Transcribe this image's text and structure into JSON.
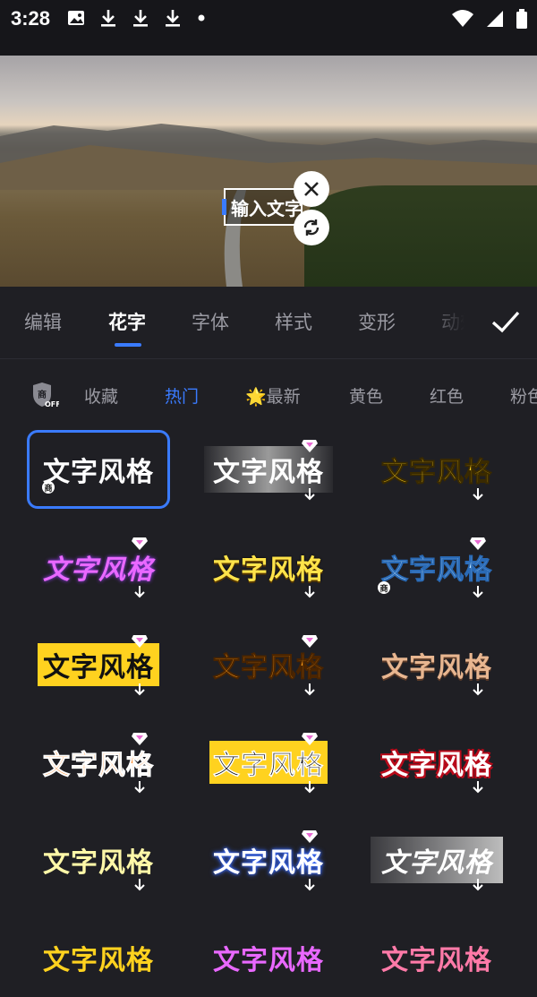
{
  "status_bar": {
    "time": "3:28",
    "icons_left": [
      "image-icon",
      "download-icon",
      "download-icon",
      "download-icon",
      "dot-icon"
    ],
    "icons_right": [
      "wifi-icon",
      "signal-icon",
      "battery-icon"
    ]
  },
  "preview": {
    "text_box_value": "输入文字",
    "controls": [
      "close-icon",
      "rotate-icon"
    ]
  },
  "tabs": [
    {
      "label": "编辑",
      "active": false
    },
    {
      "label": "花字",
      "active": true
    },
    {
      "label": "字体",
      "active": false
    },
    {
      "label": "样式",
      "active": false
    },
    {
      "label": "变形",
      "active": false
    },
    {
      "label": "动效",
      "active": false
    }
  ],
  "confirm_icon": "check-icon",
  "categories": [
    {
      "label": "",
      "icon": "shang-off-icon",
      "active": false
    },
    {
      "label": "收藏",
      "active": false
    },
    {
      "label": "热门",
      "active": true
    },
    {
      "label": "最新",
      "icon": "star-icon",
      "active": false
    },
    {
      "label": "黄色",
      "active": false
    },
    {
      "label": "红色",
      "active": false
    },
    {
      "label": "粉色",
      "active": false
    }
  ],
  "styles": {
    "sample_text": "文字风格",
    "items": [
      {
        "selected": true,
        "vip": false,
        "download": false,
        "commercial": true
      },
      {
        "selected": false,
        "vip": true,
        "download": true,
        "commercial": false
      },
      {
        "selected": false,
        "vip": false,
        "download": true,
        "commercial": false
      },
      {
        "selected": false,
        "vip": true,
        "download": true,
        "commercial": false
      },
      {
        "selected": false,
        "vip": false,
        "download": true,
        "commercial": false
      },
      {
        "selected": false,
        "vip": true,
        "download": true,
        "commercial": true
      },
      {
        "selected": false,
        "vip": true,
        "download": true,
        "commercial": false
      },
      {
        "selected": false,
        "vip": true,
        "download": true,
        "commercial": false
      },
      {
        "selected": false,
        "vip": false,
        "download": true,
        "commercial": false
      },
      {
        "selected": false,
        "vip": true,
        "download": true,
        "commercial": false
      },
      {
        "selected": false,
        "vip": true,
        "download": true,
        "commercial": false
      },
      {
        "selected": false,
        "vip": false,
        "download": true,
        "commercial": false
      },
      {
        "selected": false,
        "vip": false,
        "download": true,
        "commercial": false
      },
      {
        "selected": false,
        "vip": true,
        "download": true,
        "commercial": false
      },
      {
        "selected": false,
        "vip": false,
        "download": true,
        "commercial": false
      }
    ],
    "commercial_badge": "商"
  },
  "colors": {
    "accent": "#3a7bff",
    "background": "#1f1f24",
    "tab_inactive": "#9a9aa2"
  }
}
